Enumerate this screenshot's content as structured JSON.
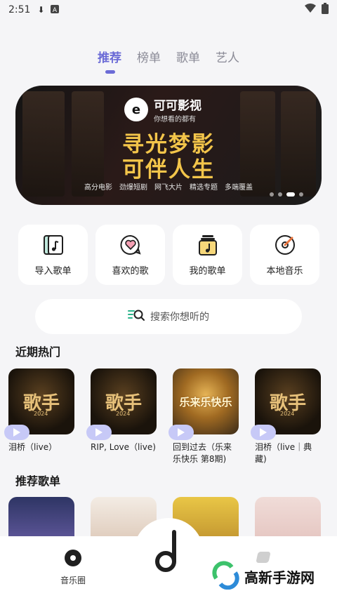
{
  "status": {
    "time": "2:51"
  },
  "tabs": [
    {
      "label": "推荐",
      "active": true
    },
    {
      "label": "榜单",
      "active": false
    },
    {
      "label": "歌单",
      "active": false
    },
    {
      "label": "艺人",
      "active": false
    }
  ],
  "banner": {
    "brand": "可可影视",
    "brand_sub": "你想看的都有",
    "slogan_line1": "寻光梦影",
    "slogan_line2": "可伴人生",
    "features": [
      "高分电影",
      "劲爆短剧",
      "网飞大片",
      "精选专题",
      "多端覆盖"
    ],
    "dot_count": 4
  },
  "quick_actions": [
    {
      "label": "导入歌单",
      "icon": "import-playlist-icon"
    },
    {
      "label": "喜欢的歌",
      "icon": "heart-chat-icon"
    },
    {
      "label": "我的歌单",
      "icon": "my-playlist-icon"
    },
    {
      "label": "本地音乐",
      "icon": "local-disc-icon"
    }
  ],
  "search": {
    "placeholder": "搜索你想听的"
  },
  "sections": {
    "hot": "近期热门",
    "recommended": "推荐歌单"
  },
  "hot_items": [
    {
      "title": "泪桥（live）",
      "cover_text": "歌手",
      "cover_year": "2024",
      "cover_style": "singer"
    },
    {
      "title": "RIP, Love（live)",
      "cover_text": "歌手",
      "cover_year": "2024",
      "cover_style": "singer"
    },
    {
      "title": "回到过去（乐来乐快乐 第8期)",
      "cover_text": "乐来乐快乐",
      "cover_year": "",
      "cover_style": "happy"
    },
    {
      "title": "泪桥（live｜典藏)",
      "cover_text": "歌手",
      "cover_year": "2024",
      "cover_style": "singer"
    }
  ],
  "bottom_nav": {
    "left_label": "音乐圈"
  },
  "watermark": {
    "text": "高新手游网"
  },
  "colors": {
    "accent": "#6b6bd6",
    "banner_text": "#f3c54a",
    "play_pill": "#c7c9f7"
  }
}
